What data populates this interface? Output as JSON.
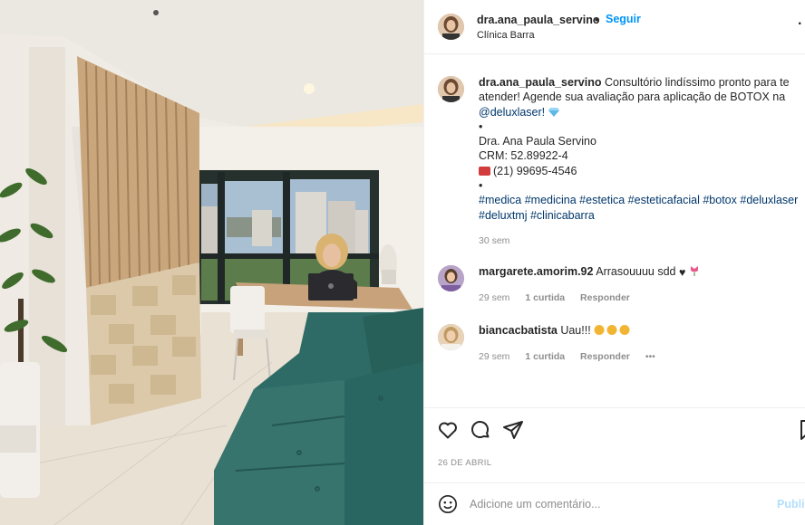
{
  "post": {
    "username": "dra.ana_paula_servino",
    "follow_label": "Seguir",
    "location": "Clínica Barra",
    "more_label": "·",
    "caption": {
      "text_lines": [
        "Consultório lindíssimo pronto para te",
        "atender! Agende sua avaliação para aplicação de BOTOX na"
      ],
      "mention": "@deluxlaser!",
      "bullet1": "•",
      "name_line": "Dra. Ana Paula Servino",
      "crm_line": "CRM: 52.89922-4",
      "phone_line": "(21) 99695-4546",
      "bullet2": "•",
      "hashtags_line1": "#medica #medicina #estetica #esteticafacial #botox #deluxlaser",
      "hashtags_line2": "#deluxtmj #clinicabarra"
    },
    "caption_time": "30 sem",
    "date": "26 DE ABRIL"
  },
  "comments": [
    {
      "username": "margarete.amorim.92",
      "text": "Arrasouuuu sdd",
      "time": "29 sem",
      "likes": "1 curtida",
      "reply": "Responder"
    },
    {
      "username": "biancacbatista",
      "text": "Uau!!!",
      "time": "29 sem",
      "likes": "1 curtida",
      "reply": "Responder",
      "more": "•••"
    }
  ],
  "add_comment": {
    "placeholder": "Adicione um comentário...",
    "publish_label": "Publicar"
  },
  "icons": [
    "heart-icon",
    "comment-icon",
    "share-icon",
    "bookmark-icon",
    "emoji-icon",
    "diamond-emoji",
    "phone-emoji",
    "clap-emoji",
    "tulip-emoji",
    "black-heart-emoji"
  ]
}
